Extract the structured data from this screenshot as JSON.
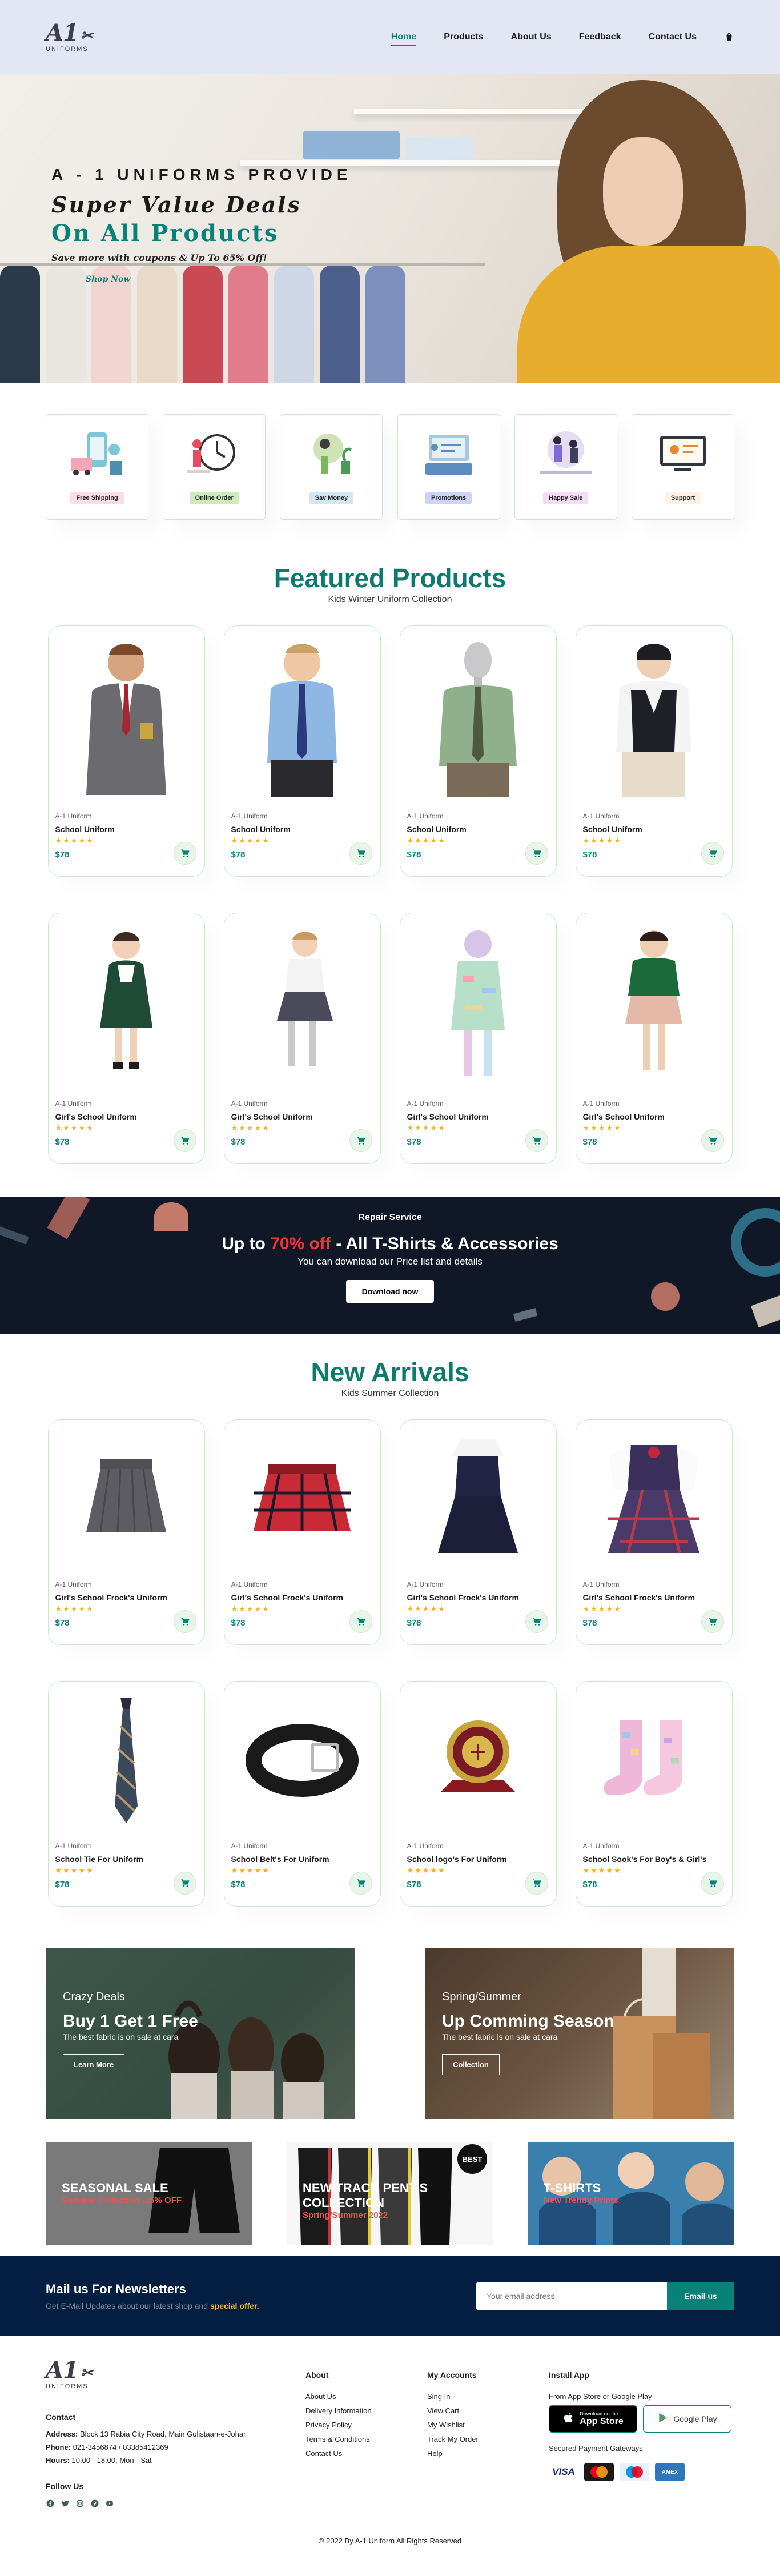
{
  "brand": {
    "logo_mark": "A1",
    "logo_sub": "UNIFORMS"
  },
  "nav": {
    "items": [
      "Home",
      "Products",
      "About Us",
      "Feedback",
      "Contact Us"
    ],
    "active": "Home",
    "cart_icon": "shopping-bag-icon"
  },
  "hero": {
    "eyebrow": "A - 1 UNIFORMS PROVIDE",
    "title": "Super Value Deals",
    "title2": "On All Products",
    "subtitle": "Save more with coupons & Up To 65% Off!",
    "cta": "Shop Now"
  },
  "features": [
    {
      "label": "Free Shipping",
      "bg": "#fddde4"
    },
    {
      "label": "Online Order",
      "bg": "#cdebbc"
    },
    {
      "label": "Sav Money",
      "bg": "#d1e8f2"
    },
    {
      "label": "Promotions",
      "bg": "#cdd4f8"
    },
    {
      "label": "Happy Sale",
      "bg": "#f6dbf6"
    },
    {
      "label": "Support",
      "bg": "#fff2e5"
    }
  ],
  "featured": {
    "title": "Featured Products",
    "subtitle": "Kids Winter Uniform Collection",
    "products": [
      {
        "brand": "A-1 Uniform",
        "name": "School Uniform",
        "stars": "★★★★★",
        "price": "$78",
        "cart_icon": "cart-icon"
      },
      {
        "brand": "A-1 Uniform",
        "name": "School Uniform",
        "stars": "★★★★★",
        "price": "$78",
        "cart_icon": "cart-icon"
      },
      {
        "brand": "A-1 Uniform",
        "name": "School Uniform",
        "stars": "★★★★★",
        "price": "$78",
        "cart_icon": "cart-icon"
      },
      {
        "brand": "A-1 Uniform",
        "name": "School Uniform",
        "stars": "★★★★★",
        "price": "$78",
        "cart_icon": "cart-icon"
      },
      {
        "brand": "A-1 Uniform",
        "name": "Girl's School Uniform",
        "stars": "★★★★★",
        "price": "$78",
        "cart_icon": "cart-icon"
      },
      {
        "brand": "A-1 Uniform",
        "name": "Girl's School Uniform",
        "stars": "★★★★★",
        "price": "$78",
        "cart_icon": "cart-icon"
      },
      {
        "brand": "A-1 Uniform",
        "name": "Girl's School Uniform",
        "stars": "★★★★★",
        "price": "$78",
        "cart_icon": "cart-icon"
      },
      {
        "brand": "A-1 Uniform",
        "name": "Girl's School Uniform",
        "stars": "★★★★★",
        "price": "$78",
        "cart_icon": "cart-icon"
      }
    ]
  },
  "banner": {
    "eyebrow": "Repair Service",
    "headline_pre": "Up to ",
    "headline_accent": "70% off",
    "headline_post": " - All T-Shirts & Accessories",
    "text": "You can download our Price list and details",
    "button": "Download now"
  },
  "arrivals": {
    "title": "New Arrivals",
    "subtitle": "Kids Summer Collection",
    "products": [
      {
        "brand": "A-1 Uniform",
        "name": "Girl's School Frock's Uniform",
        "stars": "★★★★★",
        "price": "$78",
        "cart_icon": "cart-icon"
      },
      {
        "brand": "A-1 Uniform",
        "name": "Girl's School Frock's Uniform",
        "stars": "★★★★★",
        "price": "$78",
        "cart_icon": "cart-icon"
      },
      {
        "brand": "A-1 Uniform",
        "name": "Girl's School Frock's Uniform",
        "stars": "★★★★★",
        "price": "$78",
        "cart_icon": "cart-icon"
      },
      {
        "brand": "A-1 Uniform",
        "name": "Girl's School Frock's Uniform",
        "stars": "★★★★★",
        "price": "$78",
        "cart_icon": "cart-icon"
      },
      {
        "brand": "A-1 Uniform",
        "name": "School Tie For Uniform",
        "stars": "★★★★★",
        "price": "$78",
        "cart_icon": "cart-icon"
      },
      {
        "brand": "A-1 Uniform",
        "name": "School Belt's For Uniform",
        "stars": "★★★★★",
        "price": "$78",
        "cart_icon": "cart-icon"
      },
      {
        "brand": "A-1 Uniform",
        "name": "School logo's For Uniform",
        "stars": "★★★★★",
        "price": "$78",
        "cart_icon": "cart-icon"
      },
      {
        "brand": "A-1 Uniform",
        "name": "School Sook's For Boy's & Girl's",
        "stars": "★★★★★",
        "price": "$78",
        "cart_icon": "cart-icon"
      }
    ]
  },
  "sm_banners": [
    {
      "eyebrow": "Crazy Deals",
      "title": "Buy 1 Get 1 Free",
      "text": "The best fabric is on sale at cara",
      "button": "Learn More"
    },
    {
      "eyebrow": "Spring/Summer",
      "title": "Up Comming Season",
      "text": "The best fabric is on sale at cara",
      "button": "Collection"
    }
  ],
  "tri_banners": [
    {
      "title": "SEASONAL SALE",
      "subtitle": "Summer Collection -25% OFF"
    },
    {
      "title": "NEW TRACK PENT'S COLLECTION",
      "subtitle": "Spring/Summer 2022"
    },
    {
      "title": "T-SHIRTS",
      "subtitle": "New Trendy Prints"
    }
  ],
  "newsletter": {
    "title": "Mail us For Newsletters",
    "text": "Get E-Mail Updates about our latest shop and ",
    "accent": "special offer.",
    "placeholder": "Your email address",
    "button": "Email us"
  },
  "footer": {
    "contact_title": "Contact",
    "address_label": "Address:",
    "address": "Block 13 Rabia City Road, Main Gulistaan-e-Johar",
    "phone_label": "Phone:",
    "phone": "021-3456874 / 03385412369",
    "hours_label": "Hours:",
    "hours": "10:00 - 18:00, Mon - Sat",
    "follow": "Follow Us",
    "about_title": "About",
    "about_links": [
      "About Us",
      "Delivery Information",
      "Privacy Policy",
      "Terms & Conditions",
      "Contact Us"
    ],
    "account_title": "My Accounts",
    "account_links": [
      "Sing In",
      "View Cart",
      "My Wishlist",
      "Track My Order",
      "Help"
    ],
    "app_title": "Install App",
    "app_text": "From App Store or Google Play",
    "appstore_small": "Download on the",
    "appstore_big": "App Store",
    "googleplay": "Google Play",
    "pay_title": "Secured Payment Gateways",
    "payments": [
      "VISA",
      "MC",
      "Maestro",
      "AMEX"
    ],
    "copyright": "© 2022 By A-1 Uniform All Rights Reserved"
  },
  "colors": {
    "accent": "#088178",
    "header_bg": "#e3e6f3",
    "dark_navy": "#041e42",
    "star": "#f3b519",
    "sale_red": "#ef3636"
  }
}
